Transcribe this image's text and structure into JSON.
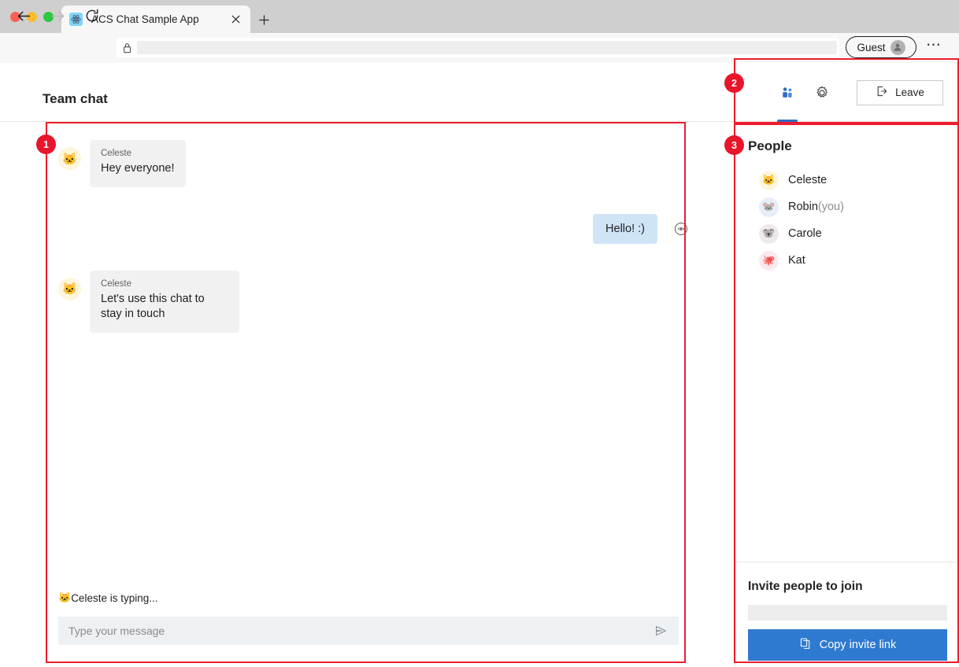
{
  "browser": {
    "tab": {
      "title": "ACS Chat Sample App",
      "favicon": "react-logo-icon",
      "close": "×"
    },
    "new_tab_label": "+",
    "nav": {
      "back": "back-arrow-icon",
      "forward": "forward-arrow-icon",
      "reload": "reload-icon"
    },
    "address_bar": {
      "lock": "lock-icon",
      "value": "",
      "placeholder": ""
    },
    "profile": {
      "label": "Guest",
      "avatar": "person-silhouette-icon"
    },
    "menu": "⋯"
  },
  "app": {
    "header": {
      "title": "Team chat",
      "tabs": [
        {
          "name": "people",
          "icon": "people-icon",
          "active": true
        },
        {
          "name": "settings",
          "icon": "gear-icon",
          "active": false
        }
      ],
      "leave_button": {
        "label": "Leave",
        "icon": "sign-out-icon"
      }
    },
    "chat": {
      "messages": [
        {
          "type": "incoming",
          "sender": "Celeste",
          "text": "Hey everyone!",
          "avatar": "🐱",
          "avatar_bg": "#fdf6dc"
        },
        {
          "type": "outgoing",
          "text": "Hello! :)",
          "status_icon": "seen-eye-icon"
        },
        {
          "type": "incoming",
          "sender": "Celeste",
          "text": "Let's use this chat to stay in touch",
          "avatar": "🐱",
          "avatar_bg": "#fdf6dc"
        }
      ],
      "typing_indicator": {
        "emoji": "🐱",
        "text": "Celeste is typing..."
      },
      "composer": {
        "value": "",
        "placeholder": "Type your message",
        "send_icon": "send-icon"
      }
    },
    "people_panel": {
      "title": "People",
      "members": [
        {
          "name": "Celeste",
          "suffix": "",
          "avatar": "🐱",
          "avatar_bg": "#fdf6dc"
        },
        {
          "name": "Robin",
          "suffix": "(you)",
          "avatar": "🐭",
          "avatar_bg": "#e7eef7"
        },
        {
          "name": "Carole",
          "suffix": "",
          "avatar": "🐨",
          "avatar_bg": "#eeeaea"
        },
        {
          "name": "Kat",
          "suffix": "",
          "avatar": "🐙",
          "avatar_bg": "#fbe9ef"
        }
      ],
      "invite": {
        "title": "Invite people to join",
        "link_value": "",
        "copy_button": {
          "label": "Copy invite link",
          "icon": "copy-icon"
        }
      }
    }
  },
  "annotations": {
    "accent_color": "#ed1c2e",
    "items": [
      {
        "id": "1",
        "label": "1",
        "target": "chat-area"
      },
      {
        "id": "2",
        "label": "2",
        "target": "header-controls"
      },
      {
        "id": "3",
        "label": "3",
        "target": "people-panel"
      }
    ]
  },
  "colors": {
    "brand_blue": "#2f7ad1",
    "tab_active_blue": "#2f6cc0",
    "incoming_bubble": "#f1f1f1",
    "outgoing_bubble": "#cfe4f7",
    "composer_bg": "#eef1f4",
    "annotation_red": "#ed1c2e"
  }
}
